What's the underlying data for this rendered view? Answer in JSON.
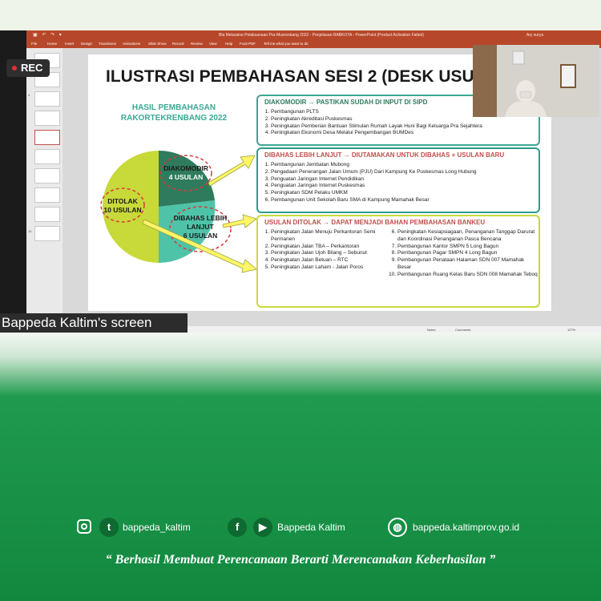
{
  "ppt": {
    "window_title": "Bla Metaraine Pelaksanaan Pra-Musrenbang 2022 - Penjelasan RABKOTA  -  PowerPoint (Product Activation Failed)",
    "user": "Ary surya",
    "menu": [
      "File",
      "Home",
      "Insert",
      "Design",
      "Transitions",
      "Animations",
      "Slide Show",
      "Record",
      "Review",
      "View",
      "Help",
      "Foxit PDF",
      "Tell me what you want to do"
    ],
    "thumb_numbers": [
      "1",
      "2",
      "3",
      "4",
      "5",
      "6",
      "7",
      "8",
      "9",
      "10"
    ],
    "status": {
      "notes": "Notes",
      "comments": "Comments",
      "zoom": "127%"
    }
  },
  "rec": "REC",
  "screen_label": "Bappeda Kaltim's screen",
  "slide": {
    "title": "ILUSTRASI PEMBAHASAN SESI 2 (DESK USULAN)",
    "hasil_line1": "HASIL PEMBAHASAN",
    "hasil_line2": "RAKORTEKRENBANG 2022",
    "pie": {
      "diakomodir": [
        "DIAKOMODIR",
        "4 USULAN"
      ],
      "dibahas": [
        "DIBAHAS LEBIH",
        "LANJUT",
        "6 USULAN"
      ],
      "ditolak": [
        "DITOLAK",
        "10 USULAN"
      ]
    },
    "box1": {
      "header": "DIAKOMODIR  →  PASTIKAN SUDAH DI INPUT DI SIPD",
      "items": [
        "Pembangunan PLTS",
        "Peningkatan Akreditasi Puskesmas",
        "Peningkatan Pemberian Bantuan Stimulan Rumah Layak Huni Bagi Keluarga Pra Sejahtera",
        "Peningkatan Ekonomi Desa Melalui Pengembangan BUMDes"
      ]
    },
    "box2": {
      "header": "DIBAHAS LEBIH LANJUT  →  DIUTAMAKAN UNTUK DIBAHAS + USULAN BARU",
      "items": [
        "Pembangunan Jembatan Mubong",
        "Pengadaan Penerangan Jalan Umum (PJU) Dari Kampung Ke Puskesmas Long Hubung",
        "Penguatan Jaringan Internet Pendidikan",
        "Penguatan Jaringan Internet Puskesmas",
        "Peningkatan SDM Pelaku UMKM",
        "Pembangunan Unit Sekolah Baru SMA di Kampung Mamahak Besar"
      ]
    },
    "box3": {
      "header": "USULAN DITOLAK  →  DAPAT MENJADI BAHAN PEMBAHASAN BANKEU",
      "items_left": [
        "Peningkatan Jalan Menuju Perkantoran Semi Permanen",
        "Peningkatan Jalan TBA – Perkantoran",
        "Peningkatan Jalan Ujoh Bilang – Sebunut",
        "Peningkatan Jalan Betuan – RTC",
        "Peningkatan Jalan Laham - Jalan Poros"
      ],
      "items_right": [
        "Peningkatan Kesiapsiagaan, Penanganan Tanggap Darurat dan Koordinasi Penanganan Pasca Bencana",
        "Pembangunan Kantor SMPN 5 Long Bagun",
        "Pembangunan Pagar SMPN 4 Long Bagun",
        "Pembangunan Penataan Halaman SDN 007 Mamahak Besar",
        "Pembangunan Ruang Kelas Baru SDN 008 Mamahak Teboq"
      ]
    }
  },
  "footer": {
    "social_handle": "bappeda_kaltim",
    "fb_yt_name": "Bappeda Kaltim",
    "website": "bappeda.kaltimprov.go.id",
    "quote": "“ Berhasil  Membuat Perencanaan Berarti Merencanakan Keberhasilan ”"
  },
  "colors": {
    "ppt_red": "#b7472a",
    "pie_lime": "#c8d93a",
    "pie_dark_green": "#2f7b5e",
    "pie_teal": "#4fc3a8",
    "brand_green": "#12883f",
    "box1_border": "#3aa893",
    "box2_border": "#2f9b8a",
    "box3_border": "#c8d93a"
  }
}
